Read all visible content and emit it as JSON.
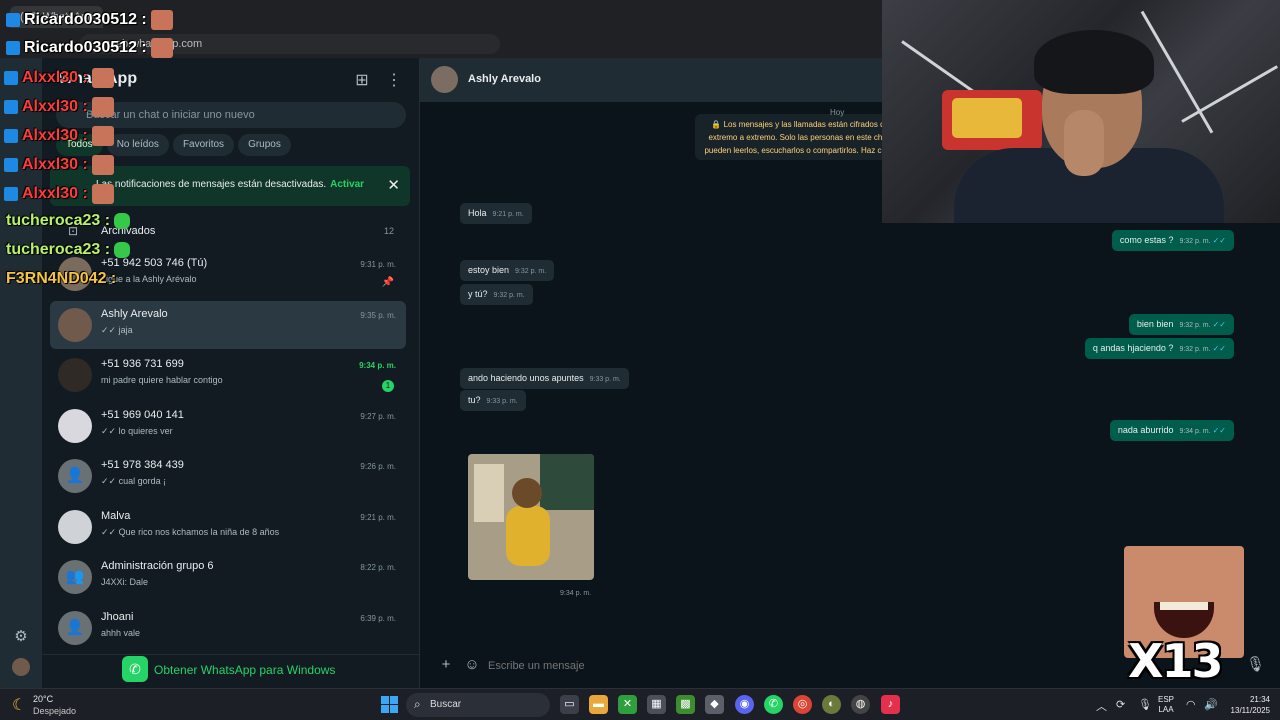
{
  "browser": {
    "tab_title": "(27) WhatsApp",
    "url": "web.whatsapp.com"
  },
  "sidebar": {
    "title": "WhatsApp",
    "search_placeholder": "Buscar un chat o iniciar uno nuevo",
    "filters": [
      "Todos",
      "No leídos",
      "Favoritos",
      "Grupos"
    ],
    "notification": {
      "text": "Las notificaciones de mensajes están desactivadas.",
      "link": "Activar"
    },
    "archived": {
      "label": "Archivados",
      "count": "12"
    },
    "chats": [
      {
        "name": "+51 942 503 746 (Tú)",
        "preview": "Ligue a la Ashly Arévalo",
        "time": "9:31 p. m.",
        "pinned": true,
        "selected": false,
        "unread": "",
        "avatar": "photo"
      },
      {
        "name": "Ashly Arevalo",
        "preview": "✓✓ jaja",
        "time": "9:35 p. m.",
        "pinned": false,
        "selected": true,
        "unread": "",
        "avatar": "photo"
      },
      {
        "name": "+51 936 731 699",
        "preview": "mi padre quiere hablar contigo",
        "time": "9:34 p. m.",
        "pinned": false,
        "selected": false,
        "unread": "1",
        "avatar": "photo"
      },
      {
        "name": "+51 969 040 141",
        "preview": "✓✓ lo quieres ver",
        "time": "9:27 p. m.",
        "pinned": false,
        "selected": false,
        "unread": "",
        "avatar": "photo"
      },
      {
        "name": "+51 978 384 439",
        "preview": "✓✓ cual gorda ¡",
        "time": "9:26 p. m.",
        "pinned": false,
        "selected": false,
        "unread": "",
        "avatar": "default"
      },
      {
        "name": "Malva",
        "preview": "✓✓ Que rico nos kchamos la niña de 8 años",
        "time": "9:21 p. m.",
        "pinned": false,
        "selected": false,
        "unread": "",
        "avatar": "photo"
      },
      {
        "name": "Administración grupo 6",
        "preview": "J4XXi: Dale",
        "time": "8:22 p. m.",
        "pinned": false,
        "selected": false,
        "unread": "",
        "avatar": "group"
      },
      {
        "name": "Jhoani",
        "preview": "ahhh vale",
        "time": "6:39 p. m.",
        "pinned": false,
        "selected": false,
        "unread": "",
        "avatar": "default"
      }
    ],
    "get_app_label": "Obtener WhatsApp para Windows"
  },
  "conversation": {
    "contact_name": "Ashly Arevalo",
    "date_label": "Hoy",
    "encryption_notice": "🔒 Los mensajes y las llamadas están cifrados de extremo a extremo. Solo las personas en este chat pueden leerlos, escucharlos o compartirlos. Haz clic para obtener más información",
    "messages": [
      {
        "dir": "in",
        "text": "Hola",
        "time": "9:21 p. m."
      },
      {
        "dir": "out",
        "text": "como estas ?",
        "time": "9:32 p. m."
      },
      {
        "dir": "in",
        "text": "estoy bien",
        "time": "9:32 p. m."
      },
      {
        "dir": "in",
        "text": "y tú?",
        "time": "9:32 p. m."
      },
      {
        "dir": "out",
        "text": "bien bien",
        "time": "9:32 p. m."
      },
      {
        "dir": "out",
        "text": "q andas hjaciendo ?",
        "time": "9:32 p. m."
      },
      {
        "dir": "in",
        "text": "ando haciendo unos apuntes",
        "time": "9:33 p. m."
      },
      {
        "dir": "in",
        "text": "tu?",
        "time": "9:33 p. m."
      },
      {
        "dir": "out",
        "text": "nada aburrido",
        "time": "9:34 p. m."
      }
    ],
    "sticker_time": "9:34 p. m.",
    "composer_placeholder": "Escribe un mensaje"
  },
  "stream_overlay": {
    "rows": [
      {
        "name": "Ricardo030512 :",
        "color": "#ffffff"
      },
      {
        "name": "Ricardo030512 :",
        "color": "#ffffff"
      },
      {
        "name": "Alxxl30 :",
        "color": "#ff3b3b"
      },
      {
        "name": "Alxxl30 :",
        "color": "#ff3b3b"
      },
      {
        "name": "Alxxl30 :",
        "color": "#ff3b3b"
      },
      {
        "name": "Alxxl30 :",
        "color": "#ff3b3b"
      },
      {
        "name": "Alxxl30 :",
        "color": "#ff3b3b"
      },
      {
        "name": "tucheroca23 :",
        "color": "#b6f26b"
      },
      {
        "name": "tucheroca23 :",
        "color": "#b6f26b"
      },
      {
        "name": "F3RN4ND042 :",
        "color": "#f5c542"
      }
    ],
    "meme_counter": "X13"
  },
  "taskbar": {
    "weather_temp": "20°C",
    "weather_desc": "Despejado",
    "search_label": "Buscar",
    "lang_top": "ESP",
    "lang_bottom": "LAA",
    "time": "21:34",
    "date": "13/11/2025"
  }
}
